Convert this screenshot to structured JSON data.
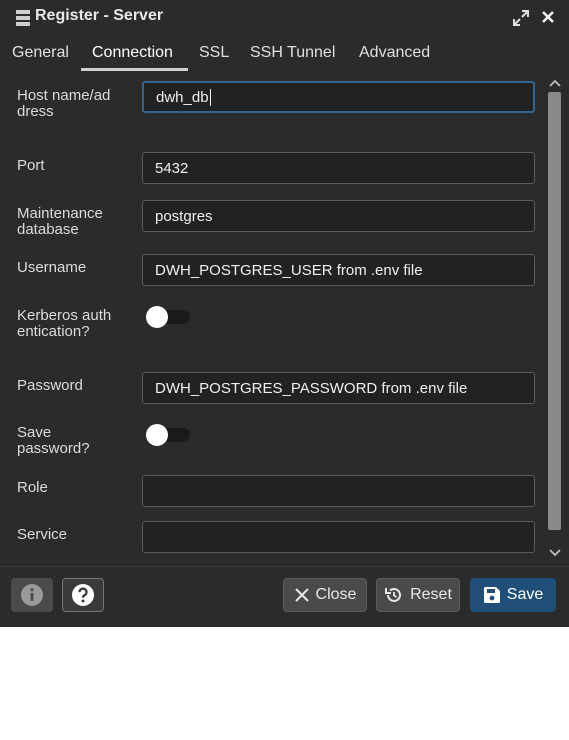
{
  "window": {
    "title": "Register - Server"
  },
  "tabs": [
    {
      "label": "General"
    },
    {
      "label": "Connection"
    },
    {
      "label": "SSL"
    },
    {
      "label": "SSH Tunnel"
    },
    {
      "label": "Advanced"
    }
  ],
  "active_tab": "Connection",
  "form": {
    "host": {
      "label": "Host name/address",
      "value": "dwh_db"
    },
    "port": {
      "label": "Port",
      "value": "5432"
    },
    "maintenance_db": {
      "label": "Maintenance database",
      "value": "postgres"
    },
    "username": {
      "label": "Username",
      "value": "DWH_POSTGRES_USER from .env file"
    },
    "kerberos": {
      "label": "Kerberos authentication?",
      "enabled": false
    },
    "password": {
      "label": "Password",
      "value": "DWH_POSTGRES_PASSWORD from .env file"
    },
    "save_password": {
      "label": "Save password?",
      "enabled": false
    },
    "role": {
      "label": "Role",
      "value": ""
    },
    "service": {
      "label": "Service",
      "value": ""
    }
  },
  "footer": {
    "close_label": "Close",
    "reset_label": "Reset",
    "save_label": "Save"
  },
  "icons": {
    "title": "server-icon",
    "expand": "expand-icon",
    "close": "close-icon",
    "info": "info-icon",
    "help": "help-icon"
  },
  "colors": {
    "accent": "#326690",
    "save_button": "#1f4f78",
    "background": "#222222"
  }
}
